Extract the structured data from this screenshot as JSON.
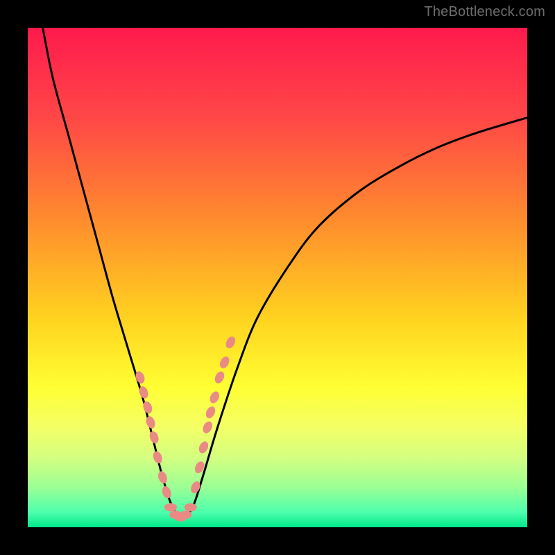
{
  "watermark": {
    "text": "TheBottleneck.com"
  },
  "chart_data": {
    "type": "line",
    "title": "",
    "xlabel": "",
    "ylabel": "",
    "xlim": [
      0,
      100
    ],
    "ylim": [
      0,
      100
    ],
    "grid": false,
    "legend": false,
    "note": "V-shaped bottleneck curve over vertical red-to-green gradient; minimum near x≈30. Salmon marker beads cluster along both branches near the trough (roughly y 8–35). Values estimated from pixels.",
    "series": [
      {
        "name": "bottleneck-curve",
        "x": [
          3,
          5,
          8,
          11,
          14,
          17,
          20,
          23,
          25,
          27,
          29,
          31,
          33,
          35,
          38,
          42,
          46,
          52,
          58,
          66,
          74,
          82,
          90,
          100
        ],
        "y": [
          100,
          90,
          79,
          68,
          57,
          46,
          36,
          26,
          18,
          10,
          4,
          2,
          4,
          10,
          20,
          32,
          42,
          52,
          60,
          67,
          72,
          76,
          79,
          82
        ]
      },
      {
        "name": "markers-left",
        "x": [
          22.5,
          23.2,
          24.0,
          24.6,
          25.3,
          26.0,
          27.0,
          27.8
        ],
        "y": [
          30,
          27,
          24,
          21,
          18,
          14,
          10,
          7
        ]
      },
      {
        "name": "markers-bottom",
        "x": [
          28.6,
          29.6,
          30.6,
          31.6,
          32.6
        ],
        "y": [
          4,
          2.5,
          2,
          2.5,
          4
        ]
      },
      {
        "name": "markers-right",
        "x": [
          33.6,
          34.4,
          35.2,
          36.0,
          36.6,
          37.4,
          38.4,
          39.4,
          40.6
        ],
        "y": [
          8,
          12,
          16,
          20,
          23,
          26,
          30,
          33,
          37
        ]
      }
    ],
    "gradient_stops": [
      {
        "pct": 0,
        "color": "#ff1a4d"
      },
      {
        "pct": 18,
        "color": "#ff4747"
      },
      {
        "pct": 38,
        "color": "#ff8a2e"
      },
      {
        "pct": 58,
        "color": "#ffd21f"
      },
      {
        "pct": 72,
        "color": "#ffff33"
      },
      {
        "pct": 80,
        "color": "#f4ff66"
      },
      {
        "pct": 86,
        "color": "#d4ff80"
      },
      {
        "pct": 92,
        "color": "#9bff94"
      },
      {
        "pct": 97,
        "color": "#4dffac"
      },
      {
        "pct": 100,
        "color": "#00e88a"
      }
    ],
    "marker_color": "#e98a85",
    "curve_color": "#000000"
  }
}
